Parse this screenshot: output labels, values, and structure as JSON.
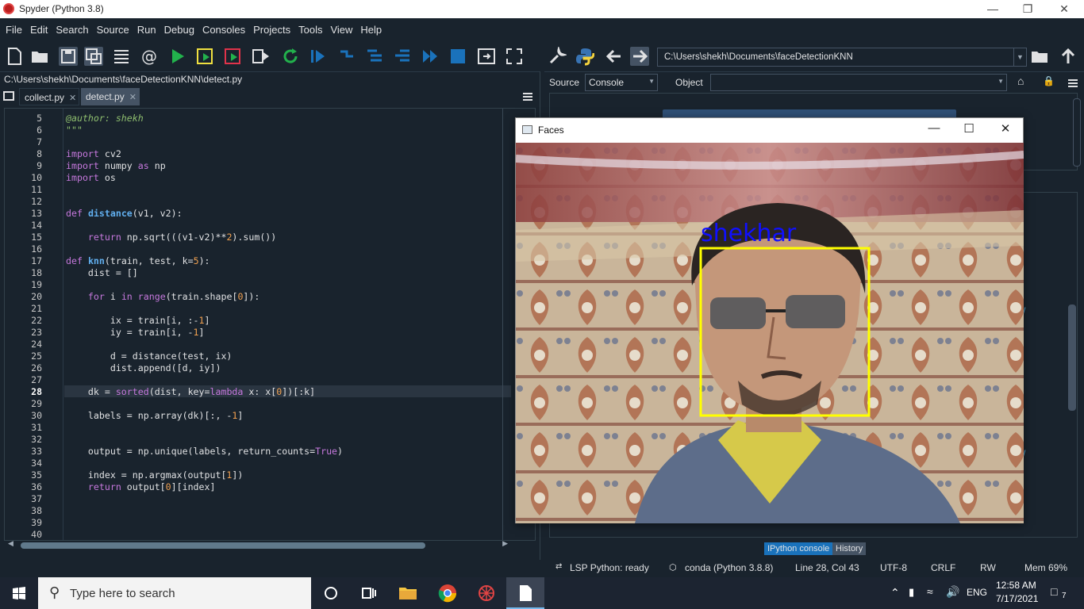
{
  "window": {
    "title": "Spyder (Python 3.8)"
  },
  "menu": [
    "File",
    "Edit",
    "Search",
    "Source",
    "Run",
    "Debug",
    "Consoles",
    "Projects",
    "Tools",
    "View",
    "Help"
  ],
  "toolbar": {
    "working_dir": "C:\\Users\\shekh\\Documents\\faceDetectionKNN"
  },
  "editor": {
    "file_path": "C:\\Users\\shekh\\Documents\\faceDetectionKNN\\detect.py",
    "tabs": [
      {
        "label": "collect.py",
        "active": false
      },
      {
        "label": "detect.py",
        "active": true
      }
    ],
    "current_line": 28,
    "lines": [
      {
        "n": "5",
        "code": "@author: shekh"
      },
      {
        "n": "6",
        "code": "\"\"\""
      },
      {
        "n": "7",
        "code": ""
      },
      {
        "n": "8",
        "code": "import cv2"
      },
      {
        "n": "9",
        "code": "import numpy as np"
      },
      {
        "n": "10",
        "code": "import os"
      },
      {
        "n": "11",
        "code": ""
      },
      {
        "n": "12",
        "code": ""
      },
      {
        "n": "13",
        "code": "def distance(v1, v2):"
      },
      {
        "n": "14",
        "code": ""
      },
      {
        "n": "15",
        "code": "    return np.sqrt(((v1-v2)**2).sum())"
      },
      {
        "n": "16",
        "code": ""
      },
      {
        "n": "17",
        "code": "def knn(train, test, k=5):"
      },
      {
        "n": "18",
        "code": "    dist = []"
      },
      {
        "n": "19",
        "code": ""
      },
      {
        "n": "20",
        "code": "    for i in range(train.shape[0]):"
      },
      {
        "n": "21",
        "code": ""
      },
      {
        "n": "22",
        "code": "        ix = train[i, :-1]"
      },
      {
        "n": "23",
        "code": "        iy = train[i, -1]"
      },
      {
        "n": "24",
        "code": ""
      },
      {
        "n": "25",
        "code": "        d = distance(test, ix)"
      },
      {
        "n": "26",
        "code": "        dist.append([d, iy])"
      },
      {
        "n": "27",
        "code": ""
      },
      {
        "n": "28",
        "code": "    dk = sorted(dist, key=lambda x: x[0])[:k]"
      },
      {
        "n": "29",
        "code": ""
      },
      {
        "n": "30",
        "code": "    labels = np.array(dk)[:, -1]"
      },
      {
        "n": "31",
        "code": ""
      },
      {
        "n": "32",
        "code": ""
      },
      {
        "n": "33",
        "code": "    output = np.unique(labels, return_counts=True)"
      },
      {
        "n": "34",
        "code": ""
      },
      {
        "n": "35",
        "code": "    index = np.argmax(output[1])"
      },
      {
        "n": "36",
        "code": "    return output[0][index]"
      },
      {
        "n": "37",
        "code": ""
      },
      {
        "n": "38",
        "code": ""
      },
      {
        "n": "39",
        "code": ""
      },
      {
        "n": "40",
        "code": ""
      }
    ]
  },
  "help_pane": {
    "source_label": "Source",
    "source_value": "Console",
    "object_label": "Object",
    "object_value": ""
  },
  "bottom_tabs": [
    "IPython console",
    "History"
  ],
  "status": {
    "lsp": "LSP Python: ready",
    "env": "conda (Python 3.8.8)",
    "position": "Line 28, Col 43",
    "encoding": "UTF-8",
    "eol": "CRLF",
    "rw": "RW",
    "mem": "Mem 69%"
  },
  "faces_window": {
    "title": "Faces",
    "label": "shekhar"
  },
  "taskbar": {
    "search_placeholder": "Type here to search",
    "lang": "ENG",
    "time": "12:58 AM",
    "date": "7/17/2021",
    "notifications": "7"
  },
  "colors": {
    "accent": "#1a72bb",
    "bg": "#19232d",
    "face_box": "#ffff00",
    "face_label": "#1010ff"
  }
}
